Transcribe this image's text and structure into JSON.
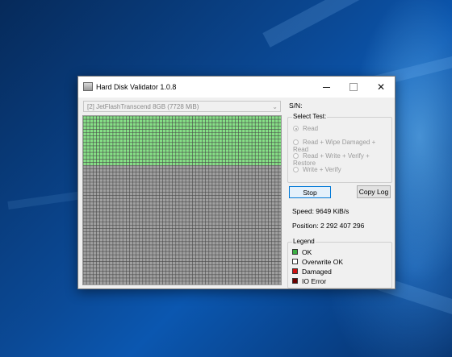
{
  "window": {
    "title": "Hard Disk Validator 1.0.8",
    "minimize_label": "—",
    "close_label": "✕"
  },
  "drive": {
    "selected": "[2] JetFlashTranscend 8GB (7728 MiB)"
  },
  "sn_label": "S/N:",
  "select_test": {
    "title": "Select Test:",
    "options": [
      {
        "label": "Read",
        "selected": true
      },
      {
        "label": "Read + Wipe Damaged + Read",
        "selected": false
      },
      {
        "label": "Read + Write + Verify + Restore",
        "selected": false
      },
      {
        "label": "Write + Verify",
        "selected": false
      }
    ]
  },
  "buttons": {
    "stop": "Stop",
    "copy_log": "Copy Log"
  },
  "status": {
    "speed": "Speed: 9649 KiB/s",
    "position": "Position: 2 292 407 296"
  },
  "legend": {
    "title": "Legend",
    "items": [
      {
        "label": "OK",
        "color": "#3cb043"
      },
      {
        "label": "Overwrite OK",
        "color": "#ffffff"
      },
      {
        "label": "Damaged",
        "color": "#d01010"
      },
      {
        "label": "IO Error",
        "color": "#6b0000"
      }
    ]
  },
  "block_map": {
    "ok_fraction": 0.29,
    "ok_color": "#86e086",
    "pending_color": "#a0a0a0",
    "line_color": "#4a4a4a"
  }
}
